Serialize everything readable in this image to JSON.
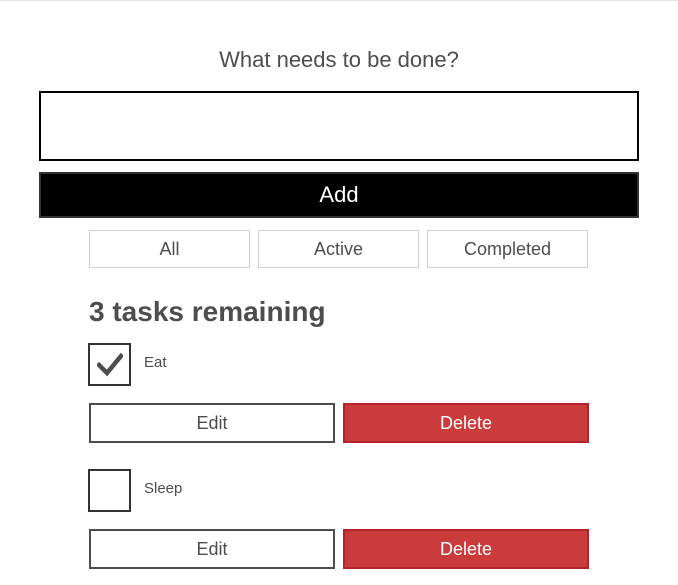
{
  "header": {
    "heading": "What needs to be done?",
    "new_todo_value": "",
    "add_label": "Add"
  },
  "filters": [
    {
      "label": "All"
    },
    {
      "label": "Active"
    },
    {
      "label": "Completed"
    }
  ],
  "remaining_text": "3 tasks remaining",
  "todos": [
    {
      "label": "Eat",
      "completed": true,
      "edit_label": "Edit",
      "delete_label": "Delete"
    },
    {
      "label": "Sleep",
      "completed": false,
      "edit_label": "Edit",
      "delete_label": "Delete"
    }
  ],
  "colors": {
    "delete": "#ca3c3c",
    "add_bg": "#000000",
    "text": "#4d4d4d"
  },
  "icons": {
    "check": "checkmark-icon"
  }
}
